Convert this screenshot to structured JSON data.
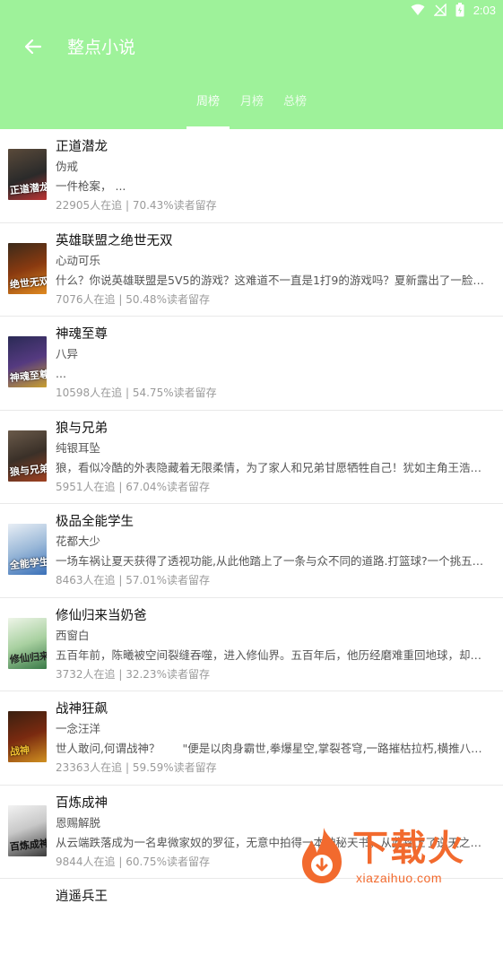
{
  "status_bar": {
    "time": "2:03"
  },
  "header": {
    "title": "整点小说"
  },
  "tabs": [
    {
      "label": "周榜"
    },
    {
      "label": "月榜"
    },
    {
      "label": "总榜"
    }
  ],
  "books": [
    {
      "title": "正道潜龙",
      "author": "伪戒",
      "desc": "一件枪案， ...",
      "stats": "22905人在追 | 70.43%读者留存",
      "cover_text": "正道潜龙"
    },
    {
      "title": "英雄联盟之绝世无双",
      "author": "心动可乐",
      "desc": "什么？你说英雄联盟是5V5的游戏？这难道不一直是1打9的游戏吗？夏新露出了一脸茫然的表情…",
      "stats": "7076人在追 | 50.48%读者留存",
      "cover_text": "绝世无双"
    },
    {
      "title": "神魂至尊",
      "author": "八异",
      "desc": "...",
      "stats": "10598人在追 | 54.75%读者留存",
      "cover_text": "神魂至尊"
    },
    {
      "title": "狼与兄弟",
      "author": "纯银耳坠",
      "desc": "狼，看似冷酷的外表隐藏着无限柔情，为了家人和兄弟甘愿牺牲自己！犹如主角王浩一样…",
      "stats": "5951人在追 | 67.04%读者留存",
      "cover_text": "狼与兄弟"
    },
    {
      "title": "极品全能学生",
      "author": "花都大少",
      "desc": "一场车祸让夏天获得了透视功能,从此他踏上了一条与众不同的道路.打篮球?一个挑五不是问题…",
      "stats": "8463人在追 | 57.01%读者留存",
      "cover_text": "全能学生"
    },
    {
      "title": "修仙归来当奶爸",
      "author": "西窗白",
      "desc": "五百年前，陈曦被空间裂缝吞噬，进入修仙界。五百年后，他历经磨难重回地球，却发现…",
      "stats": "3732人在追 | 32.23%读者留存",
      "cover_text": "修仙归来"
    },
    {
      "title": "战神狂飙",
      "author": "一念汪洋",
      "desc": "世人敢问,何谓战神？　　\"便是以肉身霸世,拳爆星空,掌裂苍穹,一路摧枯拉朽,横推八荒…",
      "stats": "23363人在追 | 59.59%读者留存",
      "cover_text": "战神"
    },
    {
      "title": "百炼成神",
      "author": "恩赐解脱",
      "desc": "从云端跌落成为一名卑微家奴的罗征，无意中拍得一本神秘天书，从此踏上了逆天之路…",
      "stats": "9844人在追 | 60.75%读者留存",
      "cover_text": "百炼成神"
    }
  ],
  "last_item": {
    "title": "逍遥兵王"
  },
  "watermark": {
    "text": "下载火",
    "url": "xiazaihuo.com"
  },
  "colors": {
    "header_bg": "#9ef29a",
    "accent": "#f26a2e"
  }
}
